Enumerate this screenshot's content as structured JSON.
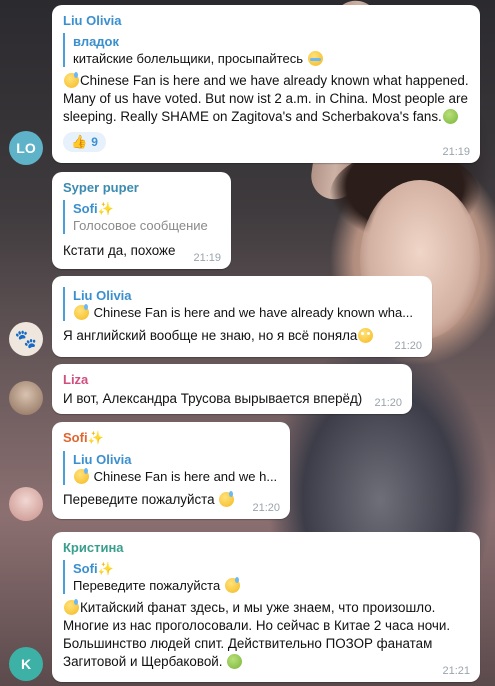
{
  "colors": {
    "lo_avatar": "#5fb3c9",
    "k_avatar": "#3db1a6",
    "liu_name": "#3a8fcf",
    "syper_name": "#3b8bb0",
    "liza_name": "#cf4f7f",
    "sofi_name": "#e0662f",
    "kristina_name": "#3a9e8f",
    "reply_bar": "#4a9fd8"
  },
  "messages": [
    {
      "sender": "Liu Olivia",
      "reply_name": "владок",
      "reply_text": "китайские болельщики, просыпайтесь",
      "body_line1": "Chinese Fan is here and we have already known what happened.",
      "body_line2": "Many of us have voted. But now ist 2 a.m. in China. Most people are",
      "body_line3": "sleeping. Really SHAME on Zagitova's and Scherbakova's fans.",
      "reaction_count": "9",
      "time": "21:19",
      "avatar": "LO"
    },
    {
      "sender": "Syper puper",
      "reply_name": "Sofi",
      "reply_text": "Голосовое сообщение",
      "body": "Кстати да, похоже",
      "time": "21:19"
    },
    {
      "reply_name": "Liu Olivia",
      "reply_text": "Chinese Fan is here and we have already known wha...",
      "body": "Я английский вообще не знаю, но я всё поняла",
      "time": "21:20"
    },
    {
      "sender": "Liza",
      "body": "И вот, Александра Трусова вырывается вперёд)",
      "time": "21:20"
    },
    {
      "sender": "Sofi",
      "reply_name": "Liu Olivia",
      "reply_text": "Chinese Fan is here and we h...",
      "body": "Переведите пожалуйста",
      "time": "21:20"
    },
    {
      "sender": "Кристина",
      "reply_name": "Sofi",
      "reply_text": "Переведите пожалуйста",
      "body_line1": "Китайский фанат здесь, и мы уже знаем, что произошло.",
      "body_line2": "Многие из нас проголосовали.  Но сейчас в Китае 2 часа ночи.",
      "body_line3": "Большинство людей спит.  Действительно ПОЗОР фанатам",
      "body_line4": "Загитовой и Щербаковой.",
      "time": "21:21",
      "avatar": "K"
    }
  ]
}
